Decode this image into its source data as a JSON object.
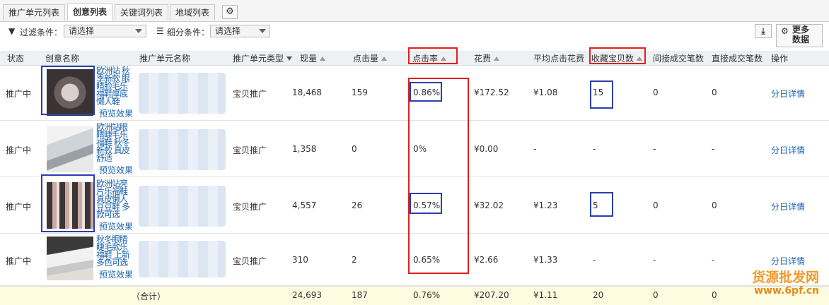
{
  "tabs": [
    "推广单元列表",
    "创意列表",
    "关键词列表",
    "地域列表"
  ],
  "filter": {
    "label1": "过滤条件：",
    "value1": "请选择",
    "label2": "细分条件：",
    "value2": "请选择",
    "more_label_1": "更多",
    "more_label_2": "数据"
  },
  "columns": [
    "状态",
    "创意名称",
    "推广单元名称",
    "推广单元类型",
    "现量",
    "点击量",
    "点击率",
    "花费",
    "平均点击花费",
    "收藏宝贝数",
    "间接成交笔数",
    "直接成交笔数",
    "操作"
  ],
  "rows": [
    {
      "status": "推广中",
      "title": "欧洲站 秋季新款 眼睛脸毛乐福鞋厚底懒人鞋",
      "preview": "预览效果",
      "type": "宝贝推广",
      "impressions": "18,468",
      "clicks": "159",
      "ctr": "0.86%",
      "cost": "¥172.52",
      "cpc": "¥1.08",
      "fav": "15",
      "indirect": "0",
      "direct": "0",
      "action": "分日详情"
    },
    {
      "status": "推广中",
      "title": "欧洲站眼睛睫毛乐福鞋 秋冬新款 真皮舒适",
      "preview": "预览效果",
      "type": "宝贝推广",
      "impressions": "1,358",
      "clicks": "0",
      "ctr": "0%",
      "cost": "¥0.00",
      "cpc": "-",
      "fav": "-",
      "indirect": "-",
      "direct": "-",
      "action": "分日详情"
    },
    {
      "status": "推广中",
      "title": "欧洲站亮片乐福鞋 真皮懒人豆豆鞋 多款可选",
      "preview": "预览效果",
      "type": "宝贝推广",
      "impressions": "4,557",
      "clicks": "26",
      "ctr": "0.57%",
      "cost": "¥32.02",
      "cpc": "¥1.23",
      "fav": "5",
      "indirect": "0",
      "direct": "0",
      "action": "分日详情"
    },
    {
      "status": "推广中",
      "title": "秋冬眼睛睫毛款乐福鞋 上新 多色可选",
      "preview": "预览效果",
      "type": "宝贝推广",
      "impressions": "310",
      "clicks": "2",
      "ctr": "0.65%",
      "cost": "¥2.66",
      "cpc": "¥1.33",
      "fav": "-",
      "indirect": "-",
      "direct": "-",
      "action": "分日详情"
    }
  ],
  "total": {
    "label": "（合计）",
    "impressions": "24,693",
    "clicks": "187",
    "ctr": "0.76%",
    "cost": "¥207.20",
    "cpc": "¥1.11",
    "fav": "20",
    "indirect": "0",
    "direct": "0"
  },
  "watermark": {
    "line1": "货源批发网",
    "line2": "www.6pf.cn"
  },
  "colors": {
    "highlight_red": "#e02020",
    "highlight_blue": "#2b3fb0",
    "link": "#1a63b0"
  }
}
